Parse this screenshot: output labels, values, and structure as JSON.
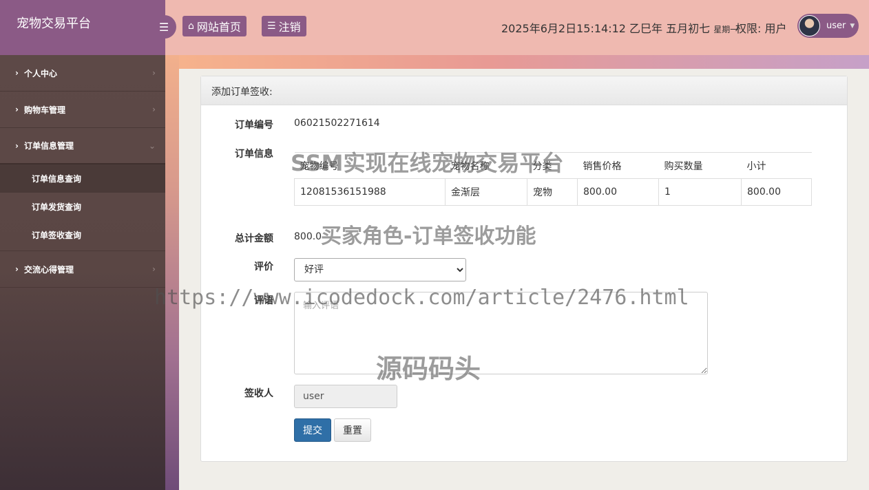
{
  "sidebar": {
    "brand": "宠物交易平台",
    "menu": [
      {
        "label": "个人中心"
      },
      {
        "label": "购物车管理"
      },
      {
        "label": "订单信息管理"
      },
      {
        "label": "交流心得管理"
      }
    ],
    "submenu": [
      {
        "label": "订单信息查询"
      },
      {
        "label": "订单发货查询"
      },
      {
        "label": "订单签收查询"
      }
    ]
  },
  "header": {
    "home_label": "网站首页",
    "logout_label": "注销",
    "datetime": "2025年6月2日15:14:12 乙巳年 五月初七",
    "weekday": "星期一",
    "permission": "权限: 用户",
    "user": "user"
  },
  "form": {
    "title": "添加订单签收:",
    "order_no_label": "订单编号",
    "order_no": "06021502271614",
    "order_info_label": "订单信息",
    "table": {
      "headers": [
        "宠物编号",
        "宠物名称",
        "分类",
        "销售价格",
        "购买数量",
        "小计"
      ],
      "rows": [
        [
          "12081536151988",
          "金渐层",
          "宠物",
          "800.00",
          "1",
          "800.00"
        ]
      ]
    },
    "total_label": "总计金额",
    "total": "800.0",
    "rating_label": "评价",
    "rating_selected": "好评",
    "comment_label": "评语",
    "comment_placeholder": "输入评语",
    "signer_label": "签收人",
    "signer": "user",
    "submit_label": "提交",
    "reset_label": "重置"
  },
  "watermarks": {
    "line1": "SSM实现在线宠物交易平台",
    "line2": "买家角色-订单签收功能",
    "line3": "https://www.icodedock.com/article/2476.html",
    "line4": "源码码头"
  },
  "colors": {
    "brand_purple": "#8b5a86",
    "header_pink": "#efb9b0",
    "submit_blue": "#2f6fa7"
  },
  "icons": {
    "menu_toggle": "bars-icon",
    "home": "home-icon",
    "logout": "list-icon"
  }
}
